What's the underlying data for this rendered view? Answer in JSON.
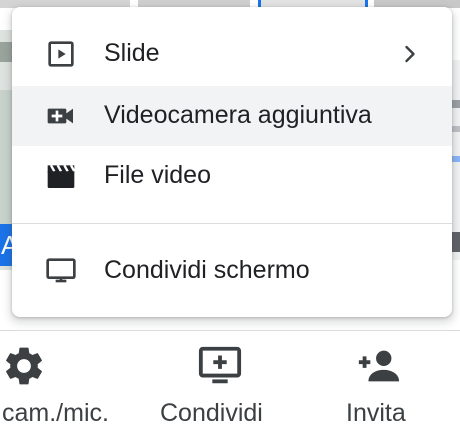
{
  "menu": {
    "items": [
      {
        "label": "Slide",
        "icon": "slideshow-icon",
        "has_submenu": true
      },
      {
        "label": "Videocamera aggiuntiva",
        "icon": "videocam-add-icon",
        "highlighted": true
      },
      {
        "label": "File video",
        "icon": "movie-clapper-icon"
      },
      {
        "label": "Condividi schermo",
        "icon": "monitor-icon"
      }
    ]
  },
  "bottom_bar": {
    "settings_label": "cam./mic.",
    "share_label": "Condividi",
    "invite_label": "Invita"
  },
  "background": {
    "partial_text": "A"
  },
  "colors": {
    "accent": "#1a73e8",
    "icon": "#3c4043",
    "highlight": "#f1f3f4",
    "divider": "#dadce0"
  }
}
